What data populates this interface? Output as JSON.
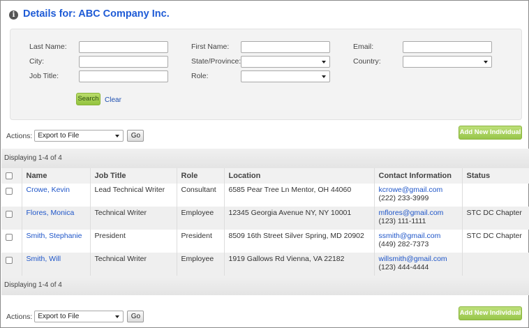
{
  "header": {
    "title": "Details for: ABC Company Inc.",
    "icon": "info-icon"
  },
  "search": {
    "labels": {
      "last_name": "Last Name:",
      "first_name": "First Name:",
      "email": "Email:",
      "city": "City:",
      "state": "State/Province:",
      "country": "Country:",
      "job_title": "Job Title:",
      "role": "Role:"
    },
    "values": {
      "last_name": "",
      "first_name": "",
      "email": "",
      "city": "",
      "job_title": "",
      "state": "",
      "country": "",
      "role": ""
    },
    "search_button": "Search",
    "clear_link": "Clear"
  },
  "actions": {
    "label": "Actions:",
    "selected": "Export to File",
    "go": "Go",
    "add_button": "Add New Individual"
  },
  "display_text": "Displaying 1-4 of 4",
  "table": {
    "columns": [
      "Name",
      "Job Title",
      "Role",
      "Location",
      "Contact Information",
      "Status"
    ],
    "rows": [
      {
        "name": "Crowe, Kevin",
        "job_title": "Lead Technical Writer",
        "role": "Consultant",
        "location": "6585 Pear Tree Ln Mentor, OH 44060",
        "email": "kcrowe@gmail.com",
        "phone": "(222) 233-3999",
        "status": ""
      },
      {
        "name": "Flores, Monica",
        "job_title": "Technical Writer",
        "role": "Employee",
        "location": "12345 Georgia Avenue NY, NY 10001",
        "email": "mflores@gmail.com",
        "phone": "(123) 111-1111",
        "status": "STC DC Chapter"
      },
      {
        "name": "Smith, Stephanie",
        "job_title": "President",
        "role": "President",
        "location": "8509 16th Street Silver Spring, MD 20902",
        "email": "ssmith@gmail.com",
        "phone": "(449) 282-7373",
        "status": "STC DC Chapter"
      },
      {
        "name": "Smith, Will",
        "job_title": "Technical Writer",
        "role": "Employee",
        "location": "1919 Gallows Rd Vienna, VA 22182",
        "email": "willsmith@gmail.com",
        "phone": "(123) 444-4444",
        "status": ""
      }
    ]
  },
  "colors": {
    "title": "#1e5bd6",
    "link": "#1e55c8",
    "add_button": "#98c64a",
    "search_button": "#93c33e"
  }
}
